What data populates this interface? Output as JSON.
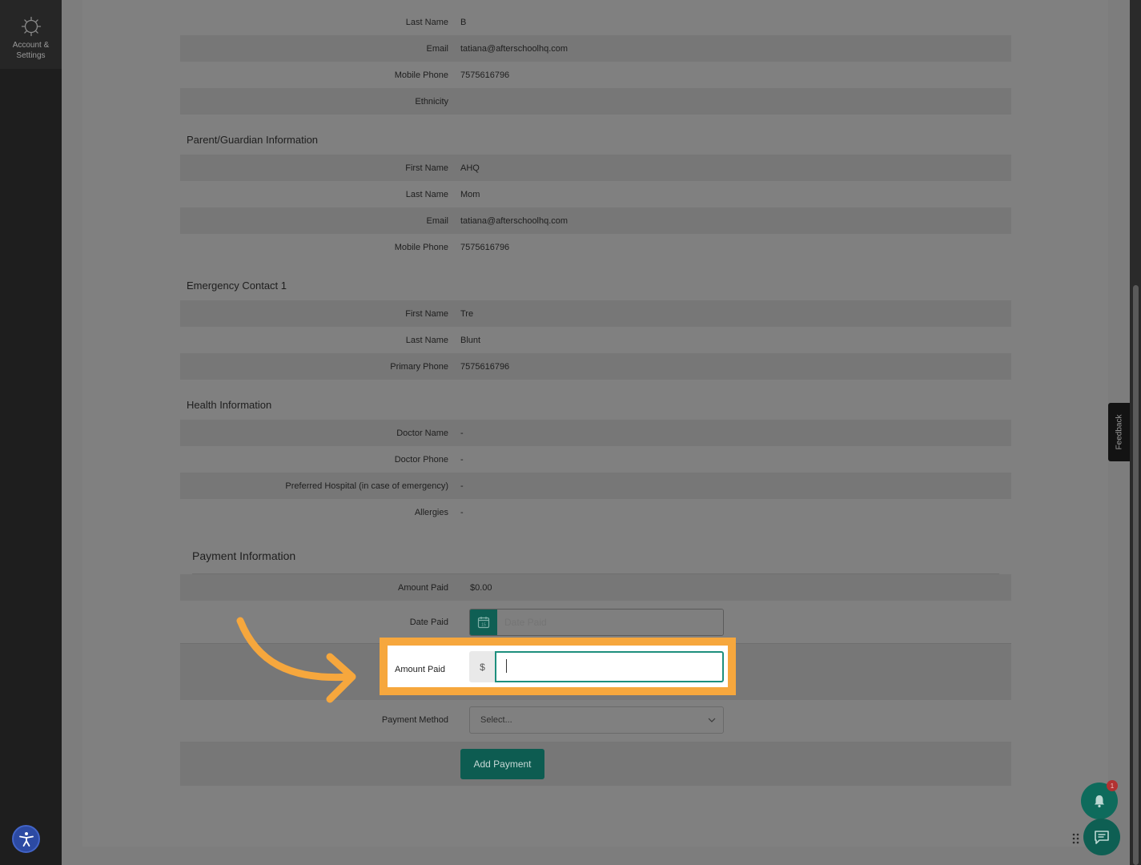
{
  "sidebar": {
    "account_label": "Account & Settings"
  },
  "student": {
    "rows": [
      {
        "label": "Last Name",
        "value": "B"
      },
      {
        "label": "Email",
        "value": "tatiana@afterschoolhq.com"
      },
      {
        "label": "Mobile Phone",
        "value": "7575616796"
      },
      {
        "label": "Ethnicity",
        "value": ""
      }
    ]
  },
  "parent": {
    "title": "Parent/Guardian Information",
    "rows": [
      {
        "label": "First Name",
        "value": "AHQ"
      },
      {
        "label": "Last Name",
        "value": "Mom"
      },
      {
        "label": "Email",
        "value": "tatiana@afterschoolhq.com"
      },
      {
        "label": "Mobile Phone",
        "value": "7575616796"
      }
    ]
  },
  "emergency": {
    "title": "Emergency Contact 1",
    "rows": [
      {
        "label": "First Name",
        "value": "Tre"
      },
      {
        "label": "Last Name",
        "value": "Blunt"
      },
      {
        "label": "Primary Phone",
        "value": "7575616796"
      }
    ]
  },
  "health": {
    "title": "Health Information",
    "rows": [
      {
        "label": "Doctor Name",
        "value": "-"
      },
      {
        "label": "Doctor Phone",
        "value": "-"
      },
      {
        "label": "Preferred Hospital (in case of emergency)",
        "value": "-"
      },
      {
        "label": "Allergies",
        "value": "-"
      }
    ]
  },
  "payment": {
    "title": "Payment Information",
    "amount_paid_label": "Amount Paid",
    "amount_paid_value": "$0.00",
    "date_paid_label": "Date Paid",
    "date_paid_placeholder": "Date Paid",
    "date_icon_text": "15",
    "amount_input_label": "Amount Paid",
    "currency_symbol": "$",
    "amount_input_value": "",
    "payment_method_label": "Payment Method",
    "payment_method_selected": "Select...",
    "add_payment_label": "Add Payment"
  },
  "feedback_label": "Feedback",
  "notification_count": "1",
  "colors": {
    "accent": "#0e6b5c",
    "highlight": "#f6a73d",
    "input_border": "#1d8f7d"
  }
}
